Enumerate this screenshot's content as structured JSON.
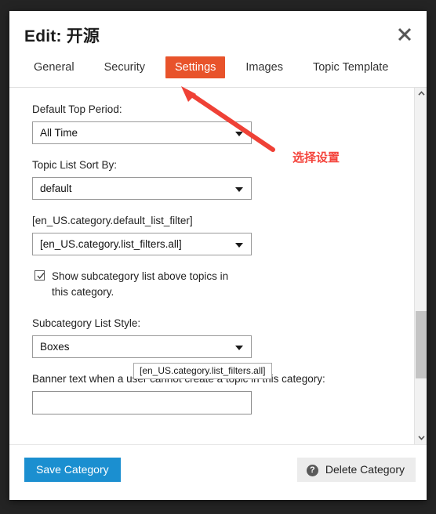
{
  "dialog": {
    "title": "Edit: 开源",
    "close_icon": "close-icon"
  },
  "tabs": [
    {
      "label": "General",
      "active": false
    },
    {
      "label": "Security",
      "active": false
    },
    {
      "label": "Settings",
      "active": true
    },
    {
      "label": "Images",
      "active": false
    },
    {
      "label": "Topic Template",
      "active": false
    }
  ],
  "form": {
    "default_top_period": {
      "label": "Default Top Period:",
      "value": "All Time"
    },
    "topic_list_sort_by": {
      "label": "Topic List Sort By:",
      "value": "default"
    },
    "default_list_filter": {
      "label": "[en_US.category.default_list_filter]",
      "value": "[en_US.category.list_filters.all]"
    },
    "show_subcategory": {
      "label": "Show subcategory list above topics in this category.",
      "checked": true
    },
    "subcategory_list_style": {
      "label": "Subcategory List Style:",
      "value": "Boxes"
    },
    "banner_text": {
      "label": "Banner text when a user cannot create a topic in this category:",
      "value": "",
      "placeholder": ""
    }
  },
  "tooltip": {
    "text": "[en_US.category.list_filters.all]"
  },
  "footer": {
    "save_label": "Save Category",
    "delete_label": "Delete Category",
    "delete_icon": "question-mark-icon",
    "question_glyph": "?"
  },
  "annotation": {
    "text": "选择设置",
    "color": "#f4443c"
  },
  "scrollbar": {
    "up_icon": "chevron-up-icon",
    "down_icon": "chevron-down-icon"
  },
  "colors": {
    "accent": "#e8532b",
    "save": "#1b8fd0",
    "backdrop": "#242424"
  }
}
